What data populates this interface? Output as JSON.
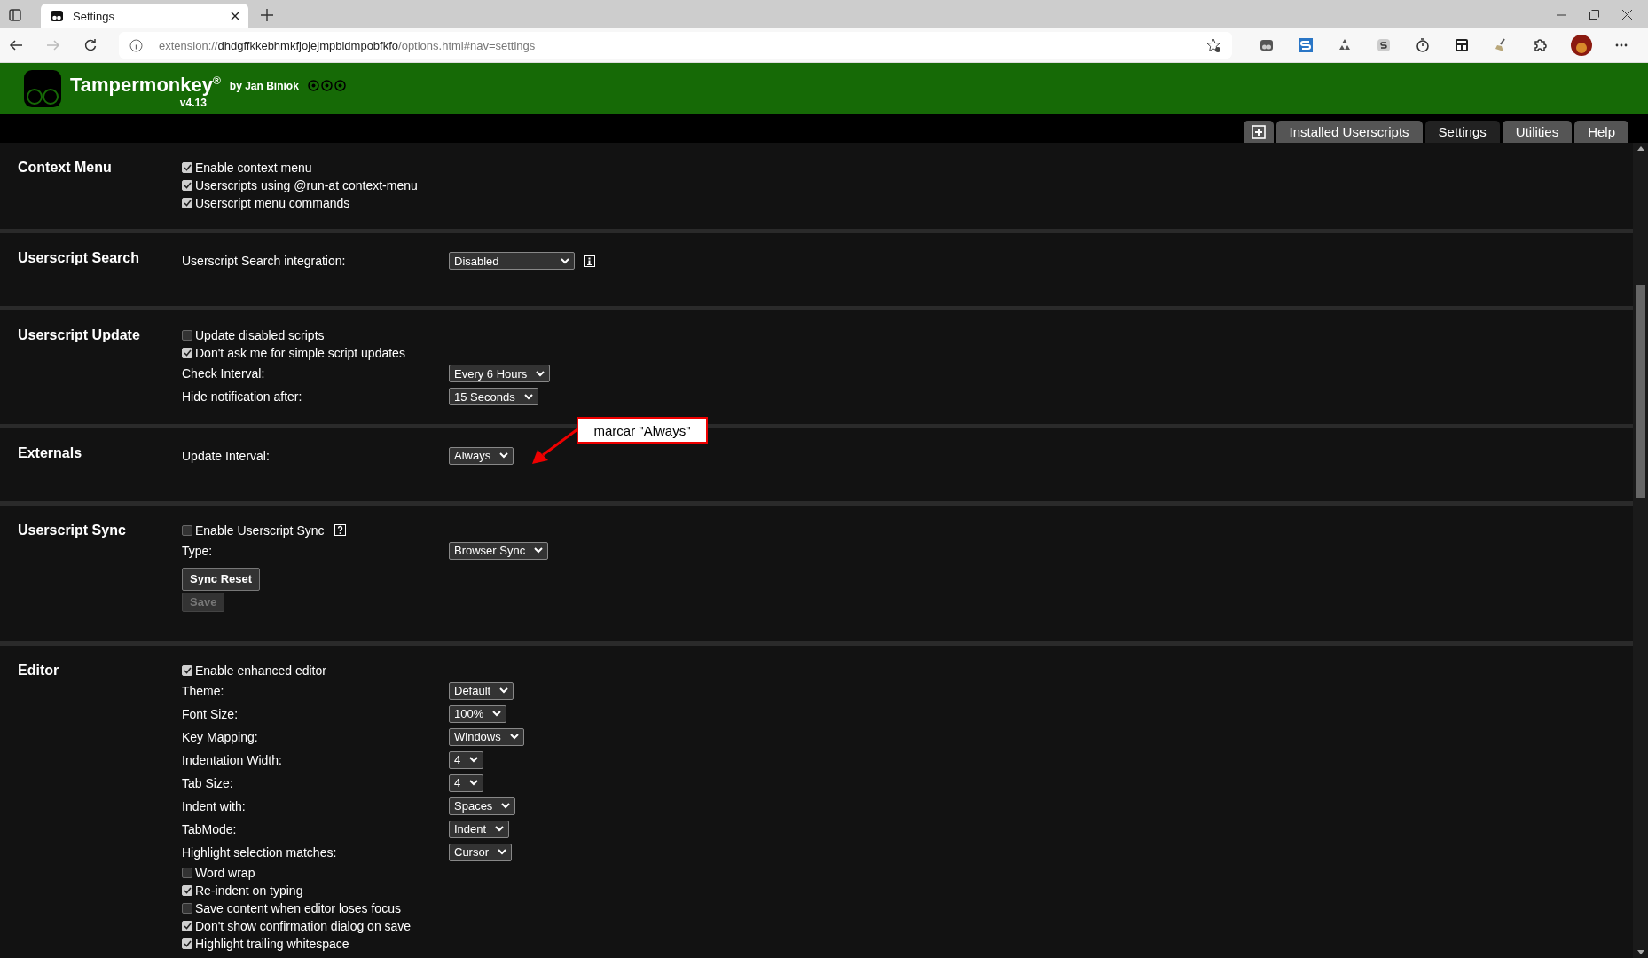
{
  "browser": {
    "tabs": [
      {
        "title": "Settings",
        "selected": true
      }
    ],
    "address": {
      "scheme": "extension://",
      "host": "dhdgffkkebhmkfjojejmpbldmpobfkfo",
      "path": "/options.html#nav=settings"
    }
  },
  "header": {
    "title": "Tampermonkey",
    "mark": "®",
    "author": "by Jan Biniok",
    "version": "v4.13"
  },
  "nav": {
    "tabs": [
      {
        "kind": "icon",
        "selected": false
      },
      {
        "kind": "text",
        "label": "Installed Userscripts",
        "selected": false
      },
      {
        "kind": "text",
        "label": "Settings",
        "selected": true
      },
      {
        "kind": "text",
        "label": "Utilities",
        "selected": false
      },
      {
        "kind": "text",
        "label": "Help",
        "selected": false
      }
    ]
  },
  "sections": [
    {
      "title": "Context Menu",
      "rows": [
        {
          "kind": "checkbox",
          "label": "Enable context menu",
          "checked": true
        },
        {
          "kind": "checkbox",
          "label": "Userscripts using @run-at context-menu",
          "checked": true
        },
        {
          "kind": "checkbox",
          "label": "Userscript menu commands",
          "checked": true
        }
      ]
    },
    {
      "title": "Userscript Search",
      "rows": [
        {
          "kind": "select",
          "label": "Userscript Search integration:",
          "value": "Disabled",
          "hint": true
        }
      ]
    },
    {
      "title": "Userscript Update",
      "rows": [
        {
          "kind": "checkbox",
          "label": "Update disabled scripts",
          "checked": false
        },
        {
          "kind": "checkbox",
          "label": "Don't ask me for simple script updates",
          "checked": true
        },
        {
          "kind": "select",
          "label": "Check Interval:",
          "value": "Every 6 Hours"
        },
        {
          "kind": "select",
          "label": "Hide notification after:",
          "value": "15 Seconds"
        }
      ]
    },
    {
      "title": "Externals",
      "rows": [
        {
          "kind": "select",
          "label": "Update Interval:",
          "value": "Always"
        }
      ]
    },
    {
      "title": "Userscript Sync",
      "rows": [
        {
          "kind": "checkbox",
          "label": "Enable Userscript Sync",
          "checked": false,
          "hint": true
        },
        {
          "kind": "select",
          "label": "Type:",
          "value": "Browser Sync"
        },
        {
          "kind": "button",
          "label": "Sync Reset",
          "disabled": false
        },
        {
          "kind": "button",
          "label": "Save",
          "disabled": true
        }
      ]
    },
    {
      "title": "Editor",
      "rows": [
        {
          "kind": "checkbox",
          "label": "Enable enhanced editor",
          "checked": true
        },
        {
          "kind": "select",
          "label": "Theme:",
          "value": "Default"
        },
        {
          "kind": "select",
          "label": "Font Size:",
          "value": "100%"
        },
        {
          "kind": "select",
          "label": "Key Mapping:",
          "value": "Windows"
        },
        {
          "kind": "select",
          "label": "Indentation Width:",
          "value": "4"
        },
        {
          "kind": "select",
          "label": "Tab Size:",
          "value": "4"
        },
        {
          "kind": "select",
          "label": "Indent with:",
          "value": "Spaces"
        },
        {
          "kind": "select",
          "label": "TabMode:",
          "value": "Indent"
        },
        {
          "kind": "select",
          "label": "Highlight selection matches:",
          "value": "Cursor"
        },
        {
          "kind": "checkbox",
          "label": "Word wrap",
          "checked": false
        },
        {
          "kind": "checkbox",
          "label": "Re-indent on typing",
          "checked": true
        },
        {
          "kind": "checkbox",
          "label": "Save content when editor loses focus",
          "checked": false
        },
        {
          "kind": "checkbox",
          "label": "Don't show confirmation dialog on save",
          "checked": true
        },
        {
          "kind": "checkbox",
          "label": "Highlight trailing whitespace",
          "checked": true
        }
      ]
    }
  ],
  "annotation": {
    "text": "marcar \"Always\""
  }
}
